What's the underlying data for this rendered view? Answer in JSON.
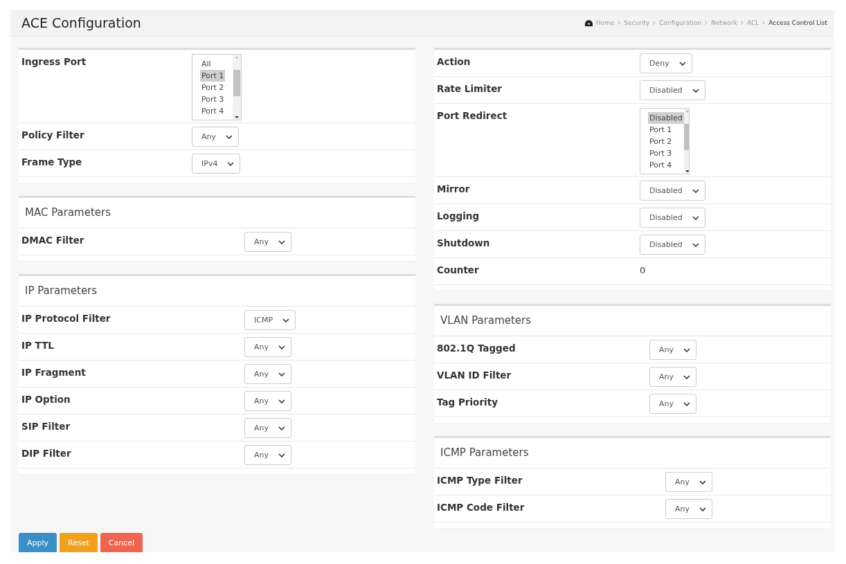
{
  "header": {
    "title": "ACE Configuration",
    "breadcrumb": [
      {
        "label": "Home",
        "current": false
      },
      {
        "label": "Security",
        "current": false
      },
      {
        "label": "Configuration",
        "current": false
      },
      {
        "label": "Network",
        "current": false
      },
      {
        "label": "ACL",
        "current": false
      },
      {
        "label": "Access Control List",
        "current": true
      }
    ]
  },
  "columns": [
    [
      {
        "rows": [
          {
            "label": "Ingress Port",
            "kind": "listbox",
            "options": [
              {
                "label": "All",
                "selected": false
              },
              {
                "label": "Port 1",
                "selected": true
              },
              {
                "label": "Port 2",
                "selected": false
              },
              {
                "label": "Port 3",
                "selected": false
              },
              {
                "label": "Port 4",
                "selected": false
              }
            ]
          },
          {
            "label": "Policy Filter",
            "kind": "select",
            "value": "Any"
          },
          {
            "label": "Frame Type",
            "kind": "select",
            "value": "IPv4"
          }
        ]
      },
      {
        "title": "MAC Parameters",
        "rows": [
          {
            "label": "DMAC Filter",
            "kind": "select",
            "value": "Any"
          }
        ]
      },
      {
        "title": "IP Parameters",
        "rows": [
          {
            "label": "IP Protocol Filter",
            "kind": "select",
            "value": "ICMP"
          },
          {
            "label": "IP TTL",
            "kind": "select",
            "value": "Any"
          },
          {
            "label": "IP Fragment",
            "kind": "select",
            "value": "Any"
          },
          {
            "label": "IP Option",
            "kind": "select",
            "value": "Any"
          },
          {
            "label": "SIP Filter",
            "kind": "select",
            "value": "Any"
          },
          {
            "label": "DIP Filter",
            "kind": "select",
            "value": "Any"
          }
        ]
      }
    ],
    [
      {
        "rows": [
          {
            "label": "Action",
            "kind": "select",
            "value": "Deny"
          },
          {
            "label": "Rate Limiter",
            "kind": "select",
            "value": "Disabled"
          },
          {
            "label": "Port Redirect",
            "kind": "listbox",
            "options": [
              {
                "label": "Disabled",
                "selected": true
              },
              {
                "label": "Port 1",
                "selected": false
              },
              {
                "label": "Port 2",
                "selected": false
              },
              {
                "label": "Port 3",
                "selected": false
              },
              {
                "label": "Port 4",
                "selected": false
              }
            ]
          },
          {
            "label": "Mirror",
            "kind": "select",
            "value": "Disabled"
          },
          {
            "label": "Logging",
            "kind": "select",
            "value": "Disabled"
          },
          {
            "label": "Shutdown",
            "kind": "select",
            "value": "Disabled"
          },
          {
            "label": "Counter",
            "kind": "text",
            "value": "0"
          }
        ]
      },
      {
        "title": "VLAN Parameters",
        "rows": [
          {
            "label": "802.1Q Tagged",
            "kind": "select",
            "value": "Any"
          },
          {
            "label": "VLAN ID Filter",
            "kind": "select",
            "value": "Any"
          },
          {
            "label": "Tag Priority",
            "kind": "select",
            "value": "Any"
          }
        ]
      },
      {
        "title": "ICMP Parameters",
        "rows": [
          {
            "label": "ICMP Type Filter",
            "kind": "select",
            "value": "Any"
          },
          {
            "label": "ICMP Code Filter",
            "kind": "select",
            "value": "Any"
          }
        ]
      }
    ]
  ],
  "buttons": [
    {
      "label": "Apply",
      "kind": "primary"
    },
    {
      "label": "Reset",
      "kind": "warning"
    },
    {
      "label": "Cancel",
      "kind": "danger"
    }
  ]
}
